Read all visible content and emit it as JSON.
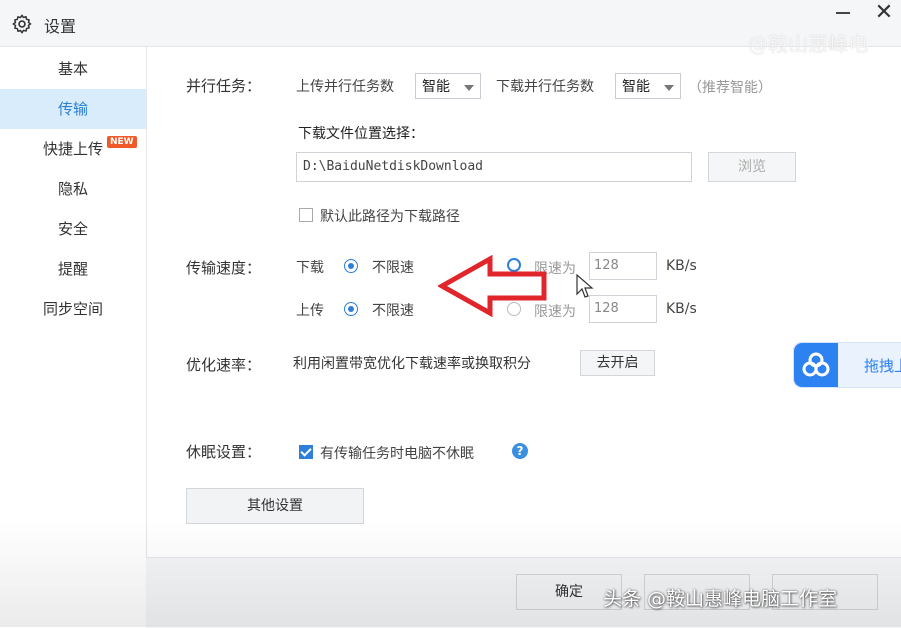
{
  "window": {
    "title": "设置",
    "close_glyph": "✕",
    "watermark_top": "@鞍山惠峰电"
  },
  "sidebar": {
    "items": [
      {
        "label": "基本",
        "active": false
      },
      {
        "label": "传输",
        "active": true
      },
      {
        "label": "快捷上传",
        "active": false,
        "badge": "NEW"
      },
      {
        "label": "隐私",
        "active": false
      },
      {
        "label": "安全",
        "active": false
      },
      {
        "label": "提醒",
        "active": false
      },
      {
        "label": "同步空间",
        "active": false
      }
    ]
  },
  "parallel": {
    "label": "并行任务：",
    "upload_label": "上传并行任务数",
    "upload_value": "智能",
    "download_label": "下载并行任务数",
    "download_value": "智能",
    "hint": "（推荐智能）"
  },
  "download_location": {
    "label": "下载文件位置选择：",
    "path": "D:\\BaiduNetdiskDownload",
    "browse_label": "浏览",
    "default_checkbox_label": "默认此路径为下载路径",
    "default_checked": false
  },
  "speed": {
    "label": "传输速度：",
    "download_label": "下载",
    "upload_label": "上传",
    "unlimited_label": "不限速",
    "limit_label": "限速为",
    "download_limit_value": "128",
    "upload_limit_value": "128",
    "unit": "KB/s"
  },
  "optimize": {
    "label": "优化速率：",
    "description": "利用闲置带宽优化下载速率或换取积分",
    "button_label": "去开启"
  },
  "sleep": {
    "label": "休眠设置：",
    "checkbox_label": "有传输任务时电脑不休眠",
    "checked": true,
    "help_glyph": "?"
  },
  "other_settings_label": "其他设置",
  "float_panel": {
    "label": "拖拽上"
  },
  "footer": {
    "ok_label": "确定",
    "watermark": "头条 @鞍山惠峰电脑工作室"
  },
  "colors": {
    "accent": "#2f7fd8",
    "sidebar_active_bg": "#d8ecfb",
    "arrow_red": "#e0262b"
  }
}
